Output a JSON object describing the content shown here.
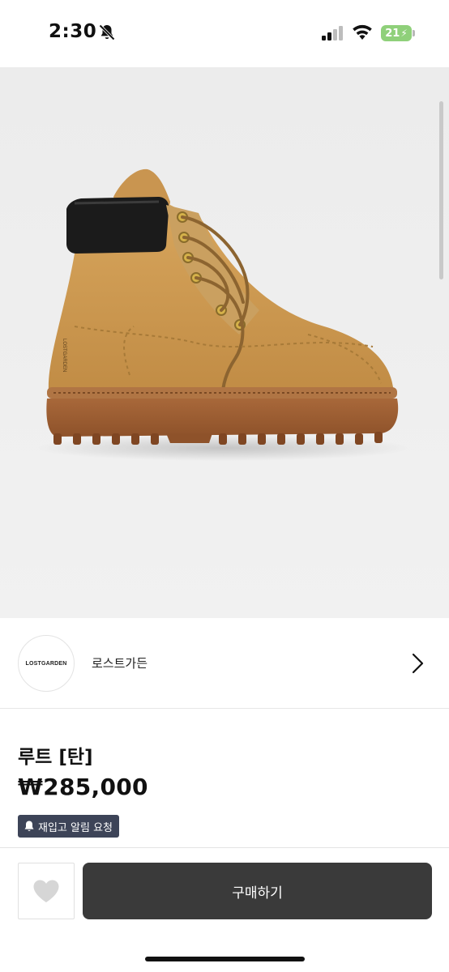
{
  "status_bar": {
    "time": "2:30",
    "battery": "21",
    "icons": [
      "bell-off-icon",
      "cellular-signal-icon",
      "wifi-icon",
      "battery-charging-icon"
    ]
  },
  "product_image": {
    "icon": "boot-product-image",
    "colors": {
      "background": "#eeeeee",
      "leather": "#c9964c",
      "collar": "#1b1b1b",
      "sole": "#9a5a2e"
    }
  },
  "seller": {
    "logo_text": "LOSTGARDEN",
    "name": "로스트가든",
    "icon": "chevron-right-icon"
  },
  "product": {
    "title": "루트 [탄]",
    "price": "₩285,000"
  },
  "restock_alert": {
    "label": "재입고 알림 요청",
    "icon": "bell-icon"
  },
  "actions": {
    "like_icon": "heart-icon",
    "buy_label": "구매하기"
  },
  "colors": {
    "buy_button_bg": "#3a3a3a",
    "restock_bg": "#3d4458",
    "battery": "#8fd07a"
  }
}
